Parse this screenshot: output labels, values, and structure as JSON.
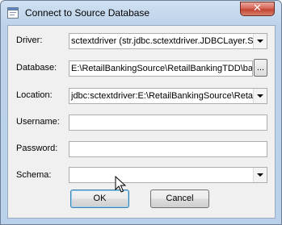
{
  "window": {
    "title": "Connect to Source Database",
    "close_glyph": "✕"
  },
  "form": {
    "driver": {
      "label": "Driver:",
      "value": "sctextdriver  (str.jdbc.sctextdriver.JDBCLayer.SC"
    },
    "database": {
      "label": "Database:",
      "value": "E:\\RetailBankingSource\\RetailBankingTDD\\ba",
      "browse_label": "..."
    },
    "location": {
      "label": "Location:",
      "value": "jdbc:sctextdriver:E:\\RetailBankingSource\\Retai"
    },
    "username": {
      "label": "Username:",
      "value": ""
    },
    "password": {
      "label": "Password:",
      "value": ""
    },
    "schema": {
      "label": "Schema:",
      "value": ""
    }
  },
  "buttons": {
    "ok": "OK",
    "cancel": "Cancel"
  },
  "icons": {
    "app": "database-window-icon",
    "close": "close-icon",
    "combo": "chevron-down-icon",
    "cursor": "mouse-pointer-icon"
  },
  "colors": {
    "titlebar": "#b9d1ea",
    "close_button": "#c44432",
    "client_background": "#f0f0f0",
    "default_button_border": "#3c7fb1"
  }
}
